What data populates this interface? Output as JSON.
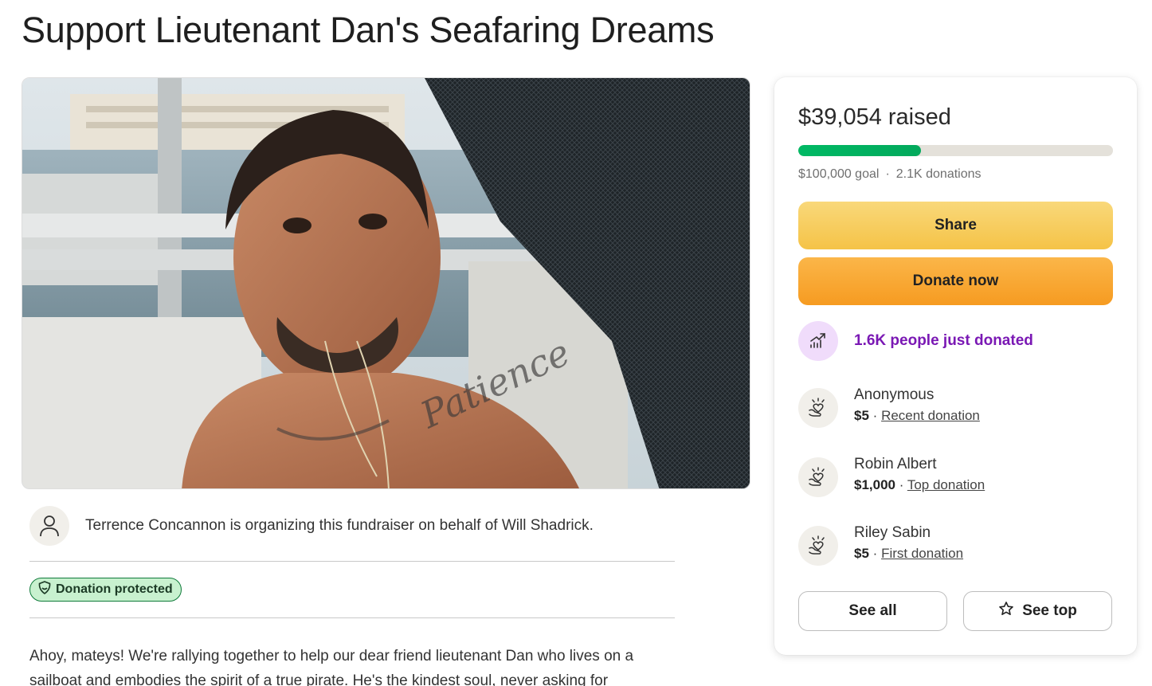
{
  "page": {
    "title": "Support Lieutenant Dan's Seafaring Dreams"
  },
  "organizer": {
    "text": "Terrence Concannon is organizing this fundraiser on behalf of Will Shadrick.",
    "icon": "person-icon"
  },
  "badge": {
    "label": "Donation protected",
    "icon": "shield-icon"
  },
  "story": {
    "text": "Ahoy, mateys! We're rallying together to help our dear friend lieutenant Dan who lives on a sailboat and embodies the spirit of a true pirate. He's the kindest soul, never asking for"
  },
  "hero_image": {
    "tattoo_text": "Patience"
  },
  "sidebar": {
    "raised": "$39,054 raised",
    "progress_fraction": 0.39,
    "goal": "$100,000 goal",
    "separator": "·",
    "donations": "2.1K donations",
    "share_label": "Share",
    "donate_label": "Donate now",
    "trending": {
      "text": "1.6K people just donated",
      "icon": "trending-up-icon"
    },
    "donors": [
      {
        "name": "Anonymous",
        "amount": "$5",
        "sep": "·",
        "tag": "Recent donation"
      },
      {
        "name": "Robin Albert",
        "amount": "$1,000",
        "sep": "·",
        "tag": "Top donation"
      },
      {
        "name": "Riley Sabin",
        "amount": "$5",
        "sep": "·",
        "tag": "First donation"
      }
    ],
    "see_all_label": "See all",
    "see_top_label": "See top"
  },
  "colors": {
    "progress": "#02a95c",
    "share": "#f7cd5c",
    "donate": "#f8a93a",
    "trending": "#7a18b4",
    "badge_bg": "#c8f1cf"
  }
}
